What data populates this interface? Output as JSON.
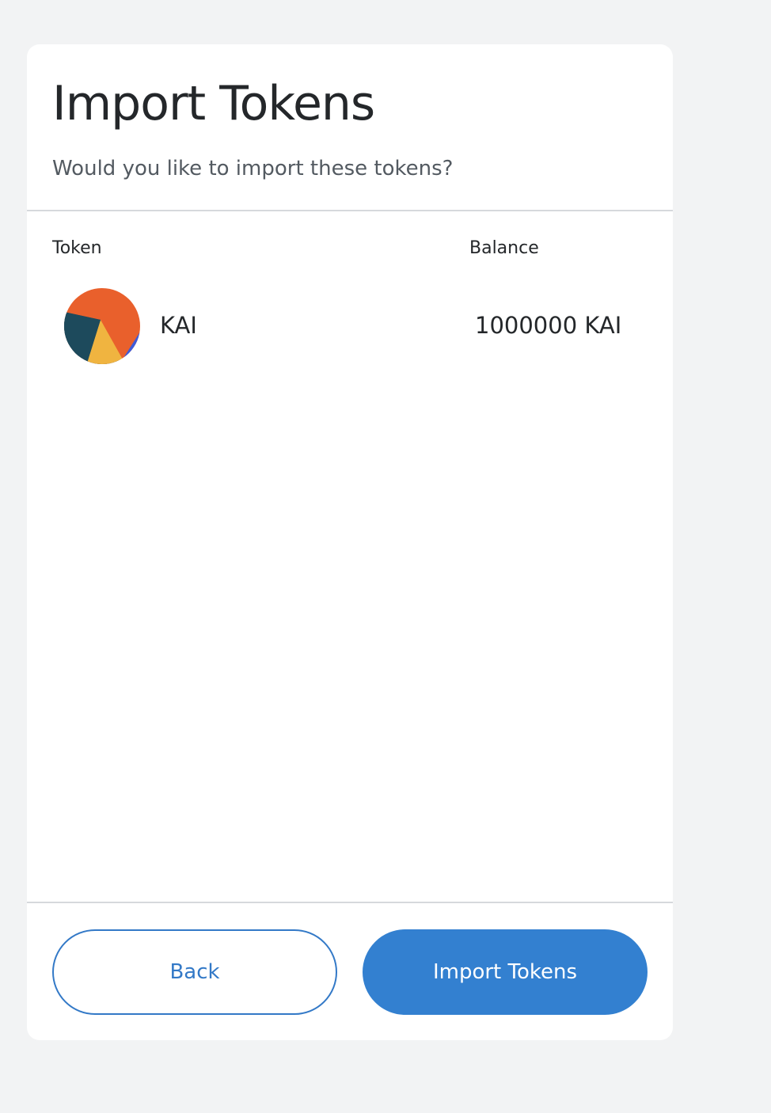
{
  "header": {
    "title": "Import Tokens",
    "subtitle": "Would you like to import these tokens?"
  },
  "table": {
    "columns": [
      "Token",
      "Balance"
    ],
    "rows": [
      {
        "icon": "jazzicon-token-icon",
        "symbol": "KAI",
        "balance": "1000000 KAI"
      }
    ]
  },
  "footer": {
    "back_label": "Back",
    "import_label": "Import Tokens"
  },
  "colors": {
    "primary": "#3380d0",
    "text": "#24272a",
    "muted_text": "#535a61",
    "divider": "#d6d9dc",
    "background": "#f2f3f4",
    "icon_orange": "#e9602c",
    "icon_navy": "#1d4a5c",
    "icon_yellow": "#f0b440",
    "icon_blue": "#3d5bd9"
  }
}
